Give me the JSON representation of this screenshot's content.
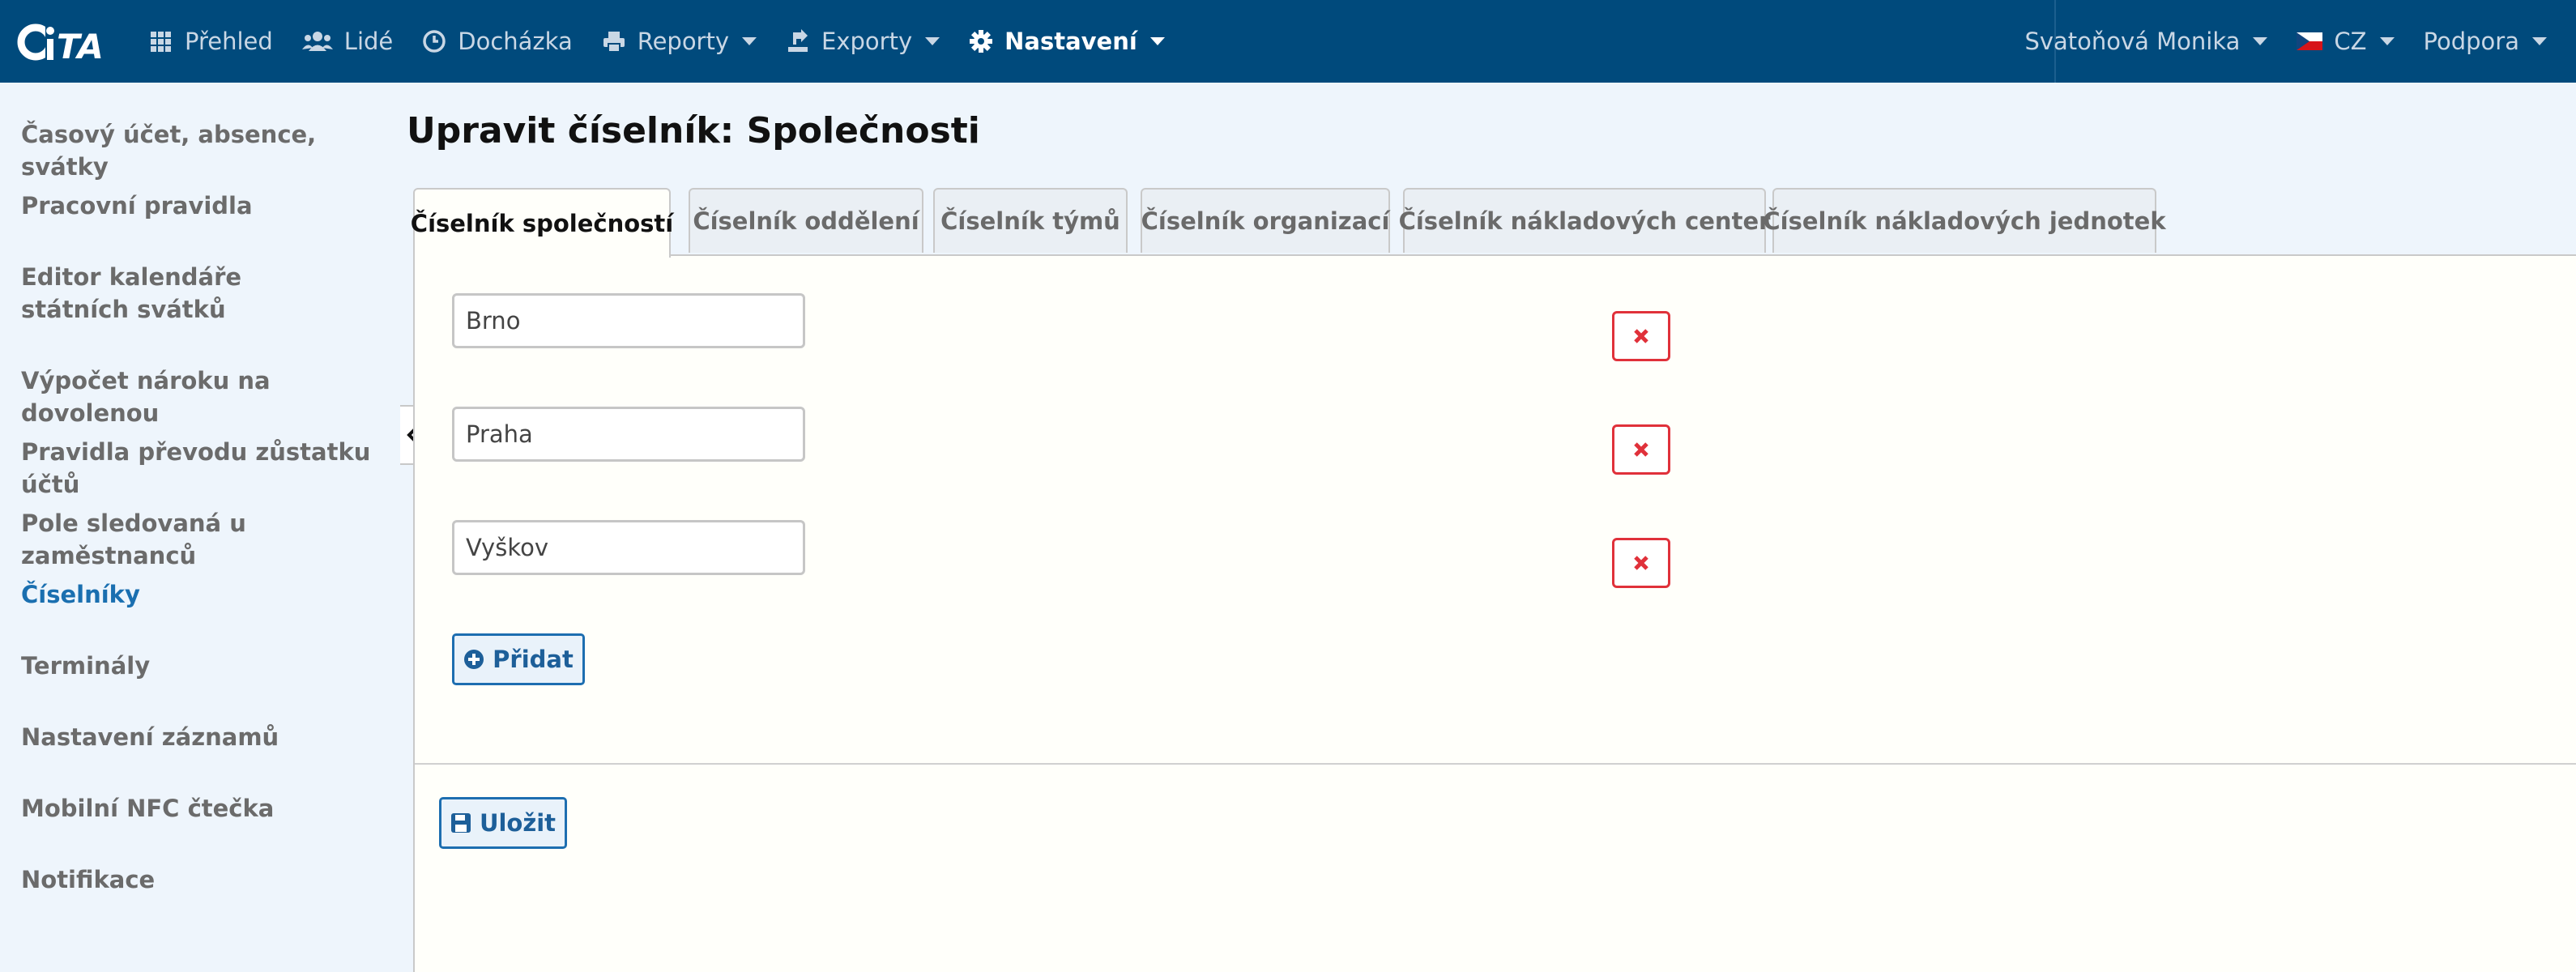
{
  "colors": {
    "navbar": "#004a7c",
    "active_link": "#1a6fb0",
    "delete": "#e0313a",
    "background": "#eef5fc",
    "panel": "#fffffa"
  },
  "nav": {
    "logo_text": "iTA",
    "items": [
      {
        "label": "Přehled",
        "icon": "grid-icon"
      },
      {
        "label": "Lidé",
        "icon": "users-icon"
      },
      {
        "label": "Docházka",
        "icon": "clock-icon"
      },
      {
        "label": "Reporty",
        "icon": "printer-icon"
      },
      {
        "label": "Exporty",
        "icon": "export-icon"
      },
      {
        "label": "Nastavení",
        "icon": "gear-icon"
      }
    ],
    "user": "Svatoňová Monika",
    "language": "CZ",
    "support": "Podpora"
  },
  "sidebar": {
    "items": [
      {
        "label": "Časový účet, absence, svátky"
      },
      {
        "label": "Pracovní pravidla"
      },
      {
        "label": "Editor kalendáře státních svátků"
      },
      {
        "label": "Výpočet nároku na dovolenou"
      },
      {
        "label": "Pravidla převodu zůstatku účtů"
      },
      {
        "label": "Pole sledovaná u zaměstnanců"
      },
      {
        "label": "Číselníky"
      },
      {
        "label": "Terminály"
      },
      {
        "label": "Nastavení záznamů"
      },
      {
        "label": "Mobilní NFC čtečka"
      },
      {
        "label": "Notifikace"
      }
    ]
  },
  "main": {
    "title": "Upravit číselník: Společnosti",
    "tabs": [
      {
        "label": "Číselník společností"
      },
      {
        "label": "Číselník oddělení"
      },
      {
        "label": "Číselník týmů"
      },
      {
        "label": "Číselník organizací"
      },
      {
        "label": "Číselník nákladových center"
      },
      {
        "label": "Číselník nákladových jednotek"
      }
    ],
    "entries": [
      {
        "value": "Brno"
      },
      {
        "value": "Praha"
      },
      {
        "value": "Vyškov"
      }
    ],
    "add_label": "Přidat",
    "save_label": "Uložit"
  }
}
